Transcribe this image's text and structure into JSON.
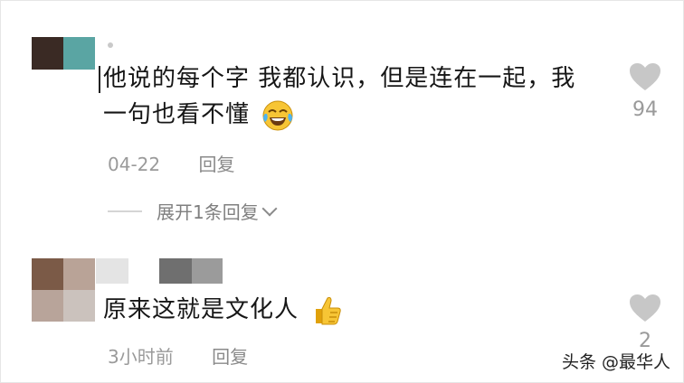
{
  "comments": [
    {
      "text_line1": "他说的每个字 我都认识，但是连在一起，我",
      "text_line2": "一句也看不懂",
      "emoji": "tears-of-joy-emoji",
      "date": "04-22",
      "reply_label": "回复",
      "likes": "94",
      "expand_label": "展开1条回复"
    },
    {
      "text": "原来这就是文化人",
      "emoji": "thumbs-up-emoji",
      "date": "3小时前",
      "reply_label": "回复",
      "likes": "2"
    }
  ],
  "watermark": "头条 @最华人",
  "colors": {
    "avatar1": [
      "#3a2a24",
      "#5aa5a3"
    ],
    "avatar2": [
      "#7b5a47",
      "#b9a397",
      "#b8a49a",
      "#cbc2bd"
    ],
    "heart": "#c7c7c7",
    "meta": "#9a9a9a"
  },
  "icons": [
    "heart-icon",
    "chevron-down-icon"
  ]
}
